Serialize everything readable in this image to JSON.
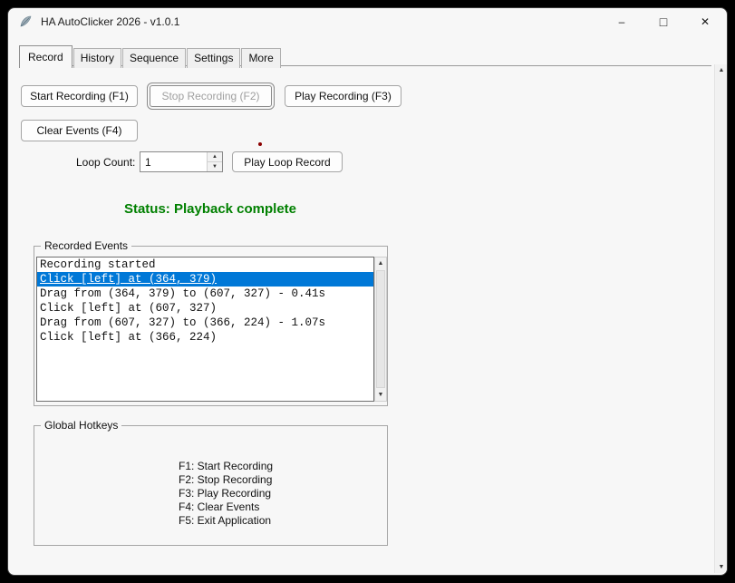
{
  "window": {
    "title": "HA AutoClicker 2026 - v1.0.1",
    "controls": {
      "minimize": "–",
      "maximize": "□",
      "close": "✕"
    }
  },
  "icons": {
    "arrow_up": "▲",
    "arrow_down": "▼"
  },
  "tabs": [
    {
      "label": "Record"
    },
    {
      "label": "History"
    },
    {
      "label": "Sequence"
    },
    {
      "label": "Settings"
    },
    {
      "label": "More"
    }
  ],
  "selected_tab": "Record",
  "record": {
    "start_button": "Start Recording (F1)",
    "stop_button": "Stop Recording (F2)",
    "play_button": "Play Recording (F3)",
    "clear_button": "Clear Events (F4)",
    "loop_label": "Loop Count:",
    "loop_value": "1",
    "play_loop_button": "Play Loop Record",
    "status": "Status: Playback complete",
    "status_color": "#008000",
    "events_group_title": "Recorded Events",
    "selection_color": "#0078d7",
    "events": [
      {
        "text": "Recording started",
        "selected": false
      },
      {
        "text": "Click [left] at (364, 379)",
        "selected": true
      },
      {
        "text": "Drag from (364, 379) to (607, 327) - 0.41s",
        "selected": false
      },
      {
        "text": "Click [left] at (607, 327)",
        "selected": false
      },
      {
        "text": "Drag from (607, 327) to (366, 224) - 1.07s",
        "selected": false
      },
      {
        "text": "Click [left] at (366, 224)",
        "selected": false
      }
    ],
    "hotkeys_group_title": "Global Hotkeys",
    "hotkeys": [
      "F1: Start Recording",
      "F2: Stop Recording",
      "F3: Play Recording",
      "F4: Clear Events",
      "F5: Exit Application"
    ]
  }
}
